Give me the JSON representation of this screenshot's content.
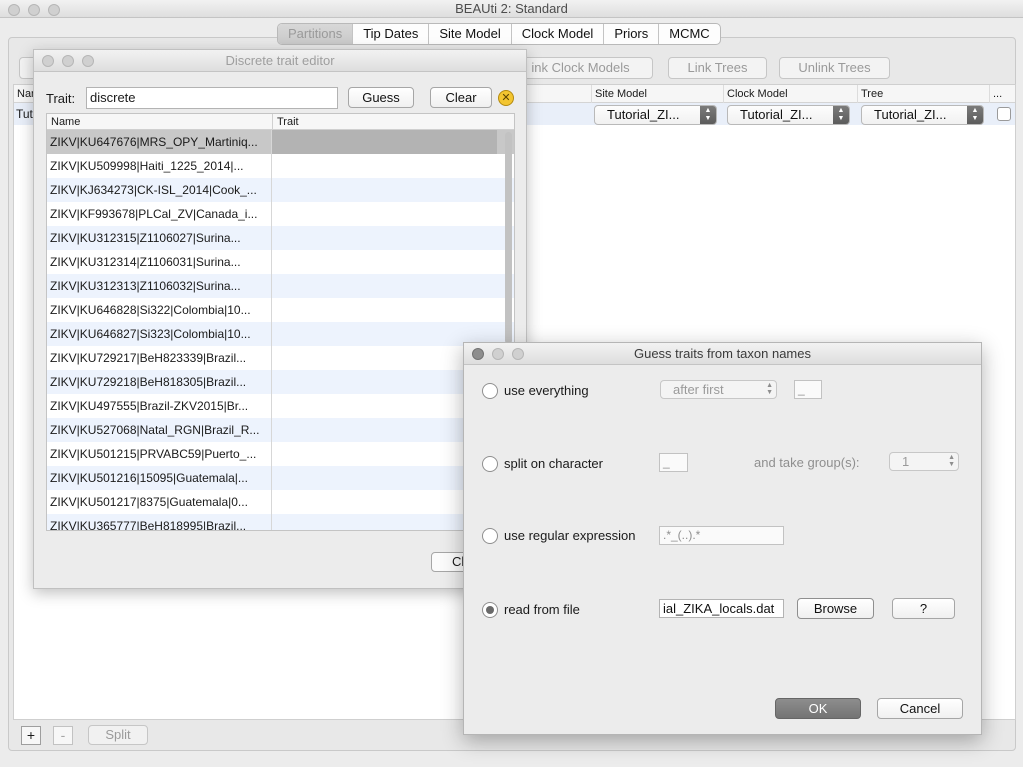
{
  "main": {
    "title": "BEAUti 2: Standard",
    "tabs": [
      "Partitions",
      "Tip Dates",
      "Site Model",
      "Clock Model",
      "Priors",
      "MCMC"
    ],
    "link_clock_label": "ink Clock Models",
    "link_trees_label": "Link Trees",
    "unlink_trees_label": "Unlink Trees",
    "columns": {
      "name": "Nar",
      "site_model": "Site Model",
      "clock_model": "Clock Model",
      "tree": "Tree",
      "more": "..."
    },
    "row": {
      "name": "Tut",
      "site_model": "Tutorial_ZI...",
      "clock_model": "Tutorial_ZI...",
      "tree": "Tutorial_ZI..."
    },
    "add_label": "+",
    "remove_label": "-",
    "split_label": "Split"
  },
  "trait_editor": {
    "title": "Discrete trait editor",
    "trait_label": "Trait:",
    "trait_value": "discrete",
    "guess_label": "Guess",
    "clear_label": "Clear",
    "clear_icon_glyph": "✕",
    "col_name": "Name",
    "col_trait": "Trait",
    "close_label": "Cl",
    "rows": [
      "ZIKV|KU647676|MRS_OPY_Martiniq...",
      "ZIKV|KU509998|Haiti_1225_2014|...",
      "ZIKV|KJ634273|CK-ISL_2014|Cook_...",
      "ZIKV|KF993678|PLCal_ZV|Canada_i...",
      "ZIKV|KU312315|Z1106027|Surina...",
      "ZIKV|KU312314|Z1106031|Surina...",
      "ZIKV|KU312313|Z1106032|Surina...",
      "ZIKV|KU646828|Si322|Colombia|10...",
      "ZIKV|KU646827|Si323|Colombia|10...",
      "ZIKV|KU729217|BeH823339|Brazil...",
      "ZIKV|KU729218|BeH818305|Brazil...",
      "ZIKV|KU497555|Brazil-ZKV2015|Br...",
      "ZIKV|KU527068|Natal_RGN|Brazil_R...",
      "ZIKV|KU501215|PRVABC59|Puerto_...",
      "ZIKV|KU501216|15095|Guatemala|...",
      "ZIKV|KU501217|8375|Guatemala|0...",
      "ZIKV|KU365777|BeH818995|Brazil..."
    ]
  },
  "guess_dialog": {
    "title": "Guess traits from taxon names",
    "use_everything": {
      "label": "use everything",
      "mode": "after first",
      "delimiter": "_"
    },
    "split_on_character": {
      "label": "split on character",
      "delimiter": "_",
      "group_label": "and take group(s):",
      "group": "1"
    },
    "regex": {
      "label": "use regular expression",
      "placeholder": ".*_(..).*"
    },
    "read_from_file": {
      "label": "read from file",
      "file": "ial_ZIKA_locals.dat",
      "browse_label": "Browse",
      "help_label": "?"
    },
    "ok_label": "OK",
    "cancel_label": "Cancel"
  }
}
